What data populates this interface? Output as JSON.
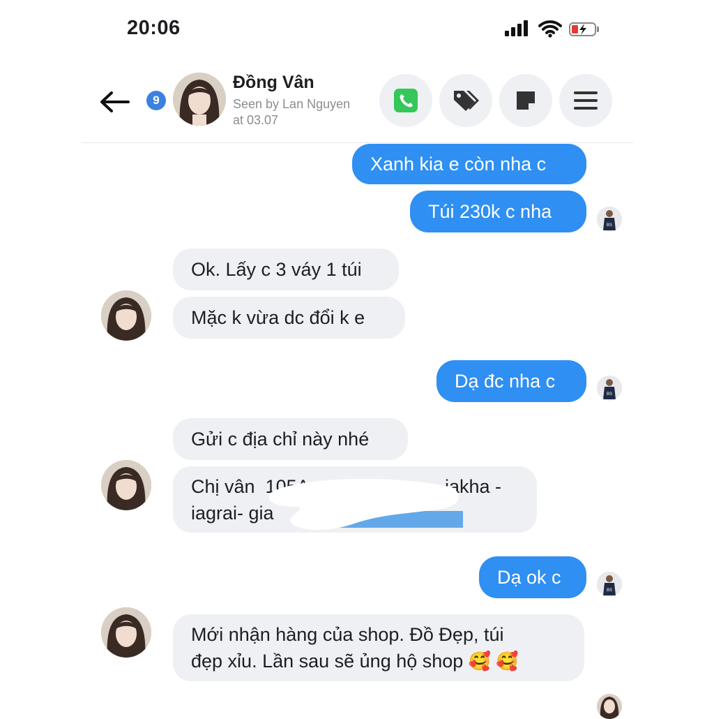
{
  "status": {
    "time": "20:06",
    "icons": [
      "signal-icon",
      "wifi-icon",
      "battery-charging-icon"
    ]
  },
  "header": {
    "unread_count": "9",
    "contact_name": "Đồng Vân",
    "seen_line1": "Seen by Lan Nguyen",
    "seen_line2": "at 03.07",
    "actions": [
      "phone-icon",
      "tag-icon",
      "note-icon",
      "menu-icon"
    ]
  },
  "messages": [
    {
      "side": "out",
      "text": "Xanh kia e còn nha c"
    },
    {
      "side": "out",
      "text": "Túi 230k c nha"
    },
    {
      "side": "in",
      "text": "Ok. Lấy c 3 váy 1 túi"
    },
    {
      "side": "in",
      "text": "Mặc k vừa dc đổi k e"
    },
    {
      "side": "out",
      "text": "Dạ đc nha c"
    },
    {
      "side": "in",
      "text": "Gửi c địa chỉ này nhé"
    },
    {
      "side": "in",
      "text_line1": "Chị vân  105A",
      "text_line1_end": "iakha -",
      "text_line2": "iagrai- gia",
      "redacted": true
    },
    {
      "side": "out",
      "text": "Dạ ok c"
    },
    {
      "side": "in",
      "text_line1": "Mới nhận hàng của shop. Đồ Đẹp, túi",
      "text_line2": "đẹp xỉu. Lần sau sẽ ủng hộ shop",
      "emoji": "🥰 🥰"
    }
  ],
  "colors": {
    "outgoing": "#2f8ff2",
    "incoming": "#eef0f3",
    "badge": "#3b82e0",
    "phone": "#34c759"
  }
}
